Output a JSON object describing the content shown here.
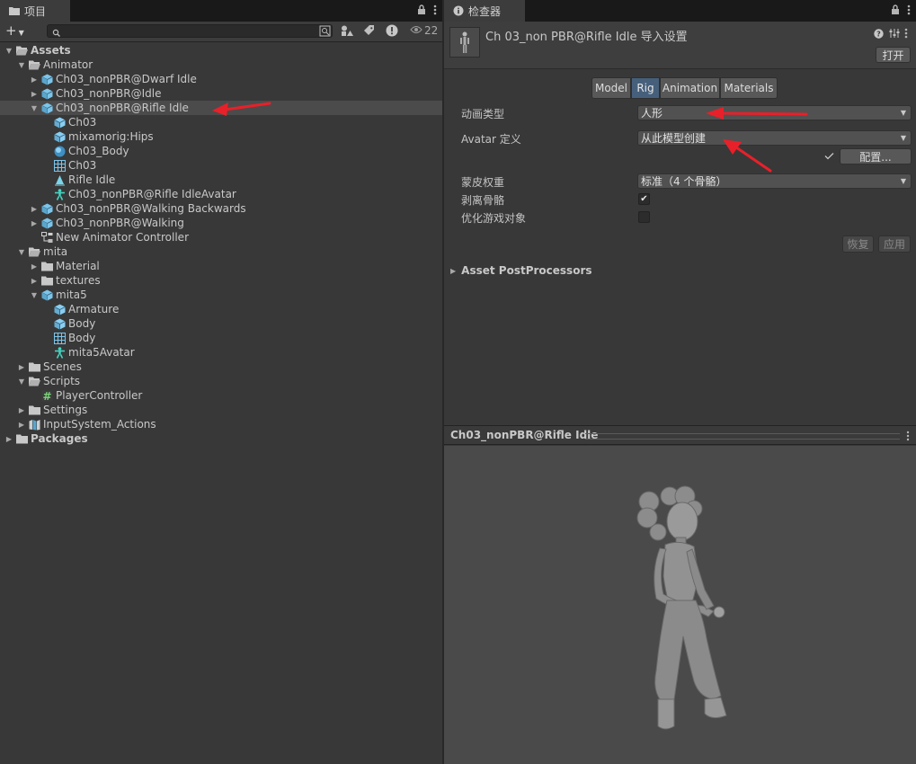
{
  "project_panel": {
    "tab_label": "项目",
    "hidden_count": "22",
    "tree": [
      {
        "label": "Assets",
        "depth": 0,
        "expanded": true,
        "icon": "folder-open-icon",
        "bold": true
      },
      {
        "label": "Animator",
        "depth": 1,
        "expanded": true,
        "icon": "folder-open-icon"
      },
      {
        "label": "Ch03_nonPBR@Dwarf Idle",
        "depth": 2,
        "expanded": false,
        "icon": "model-prefab-icon"
      },
      {
        "label": "Ch03_nonPBR@Idle",
        "depth": 2,
        "expanded": false,
        "icon": "model-prefab-icon"
      },
      {
        "label": "Ch03_nonPBR@Rifle Idle",
        "depth": 2,
        "expanded": true,
        "icon": "model-prefab-icon",
        "selected": true
      },
      {
        "label": "Ch03",
        "depth": 3,
        "icon": "cube-icon"
      },
      {
        "label": "mixamorig:Hips",
        "depth": 3,
        "icon": "cube-icon"
      },
      {
        "label": "Ch03_Body",
        "depth": 3,
        "icon": "sphere-material-icon"
      },
      {
        "label": "Ch03",
        "depth": 3,
        "icon": "mesh-grid-icon"
      },
      {
        "label": "Rifle Idle",
        "depth": 3,
        "icon": "animation-clip-icon"
      },
      {
        "label": "Ch03_nonPBR@Rifle IdleAvatar",
        "depth": 3,
        "icon": "avatar-icon"
      },
      {
        "label": "Ch03_nonPBR@Walking Backwards",
        "depth": 2,
        "expanded": false,
        "icon": "model-prefab-icon"
      },
      {
        "label": "Ch03_nonPBR@Walking",
        "depth": 2,
        "expanded": false,
        "icon": "model-prefab-icon"
      },
      {
        "label": "New Animator Controller",
        "depth": 2,
        "icon": "animator-controller-icon"
      },
      {
        "label": "mita",
        "depth": 1,
        "expanded": true,
        "icon": "folder-open-icon"
      },
      {
        "label": "Material",
        "depth": 2,
        "expanded": false,
        "icon": "folder-icon"
      },
      {
        "label": "textures",
        "depth": 2,
        "expanded": false,
        "icon": "folder-icon"
      },
      {
        "label": "mita5",
        "depth": 2,
        "expanded": true,
        "icon": "model-prefab-icon"
      },
      {
        "label": "Armature",
        "depth": 3,
        "icon": "cube-icon"
      },
      {
        "label": "Body",
        "depth": 3,
        "icon": "cube-icon"
      },
      {
        "label": "Body",
        "depth": 3,
        "icon": "mesh-grid-icon"
      },
      {
        "label": "mita5Avatar",
        "depth": 3,
        "icon": "avatar-icon"
      },
      {
        "label": "Scenes",
        "depth": 1,
        "expanded": false,
        "icon": "folder-icon"
      },
      {
        "label": "Scripts",
        "depth": 1,
        "expanded": true,
        "icon": "folder-open-icon"
      },
      {
        "label": "PlayerController",
        "depth": 2,
        "icon": "csharp-script-icon"
      },
      {
        "label": "Settings",
        "depth": 1,
        "expanded": false,
        "icon": "folder-icon"
      },
      {
        "label": "InputSystem_Actions",
        "depth": 1,
        "expanded": false,
        "icon": "input-actions-icon"
      },
      {
        "label": "Packages",
        "depth": 0,
        "expanded": false,
        "icon": "folder-icon",
        "bold": true
      }
    ]
  },
  "inspector": {
    "tab_label": "检查器",
    "title": "Ch 03_non PBR@Rifle Idle 导入设置",
    "open_button": "打开",
    "tabs": [
      "Model",
      "Rig",
      "Animation",
      "Materials"
    ],
    "active_tab": "Rig",
    "fields": {
      "animation_type_label": "动画类型",
      "animation_type_value": "人形",
      "avatar_def_label": "Avatar 定义",
      "avatar_def_value": "从此模型创建",
      "configure_button": "配置...",
      "skin_weights_label": "蒙皮权重",
      "skin_weights_value": "标准（4 个骨骼）",
      "strip_bones_label": "剥离骨骼",
      "strip_bones_checked": true,
      "optimize_label": "优化游戏对象",
      "optimize_checked": false
    },
    "revert_button": "恢复",
    "apply_button": "应用",
    "asset_postprocessors": "Asset PostProcessors",
    "preview_title": "Ch03_nonPBR@Rifle Idle"
  },
  "colors": {
    "folder": "#c8c8c8",
    "model_blue": "#7cc4ea",
    "avatar_teal": "#46d6c4",
    "annotation_red": "#e8202a",
    "tab_active": "#46607c"
  }
}
